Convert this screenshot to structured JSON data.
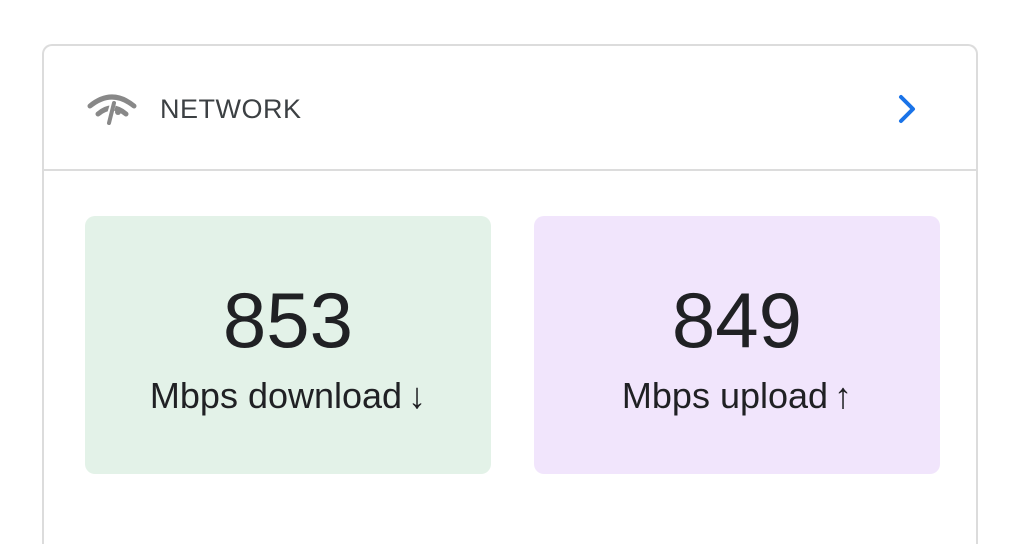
{
  "network_card": {
    "icon": "wifi-icon",
    "title": "NETWORK",
    "chevron_icon": "chevron-right-icon",
    "accent_color": "#1a73e8",
    "download": {
      "value": "853",
      "label": "Mbps download",
      "arrow": "↓",
      "background": "#e3f2e8"
    },
    "upload": {
      "value": "849",
      "label": "Mbps upload",
      "arrow": "↑",
      "background": "#f1e5fc"
    }
  }
}
